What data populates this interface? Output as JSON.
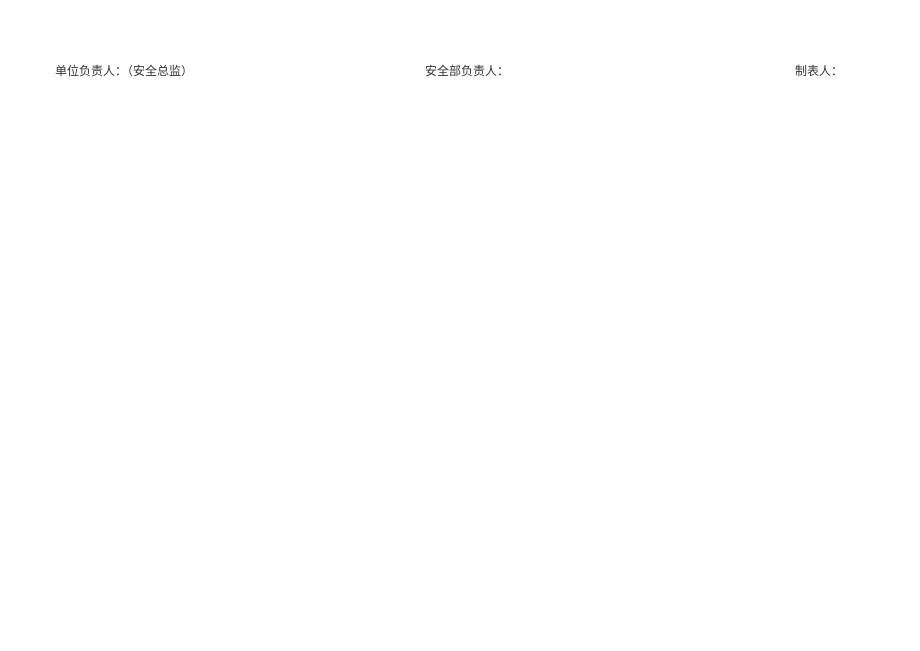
{
  "signatures": {
    "unit_leader": {
      "label": "单位负责人：",
      "note": "（安全总监）"
    },
    "safety_leader": {
      "label": "安全部负责人："
    },
    "preparer": {
      "label": "制表人："
    }
  }
}
